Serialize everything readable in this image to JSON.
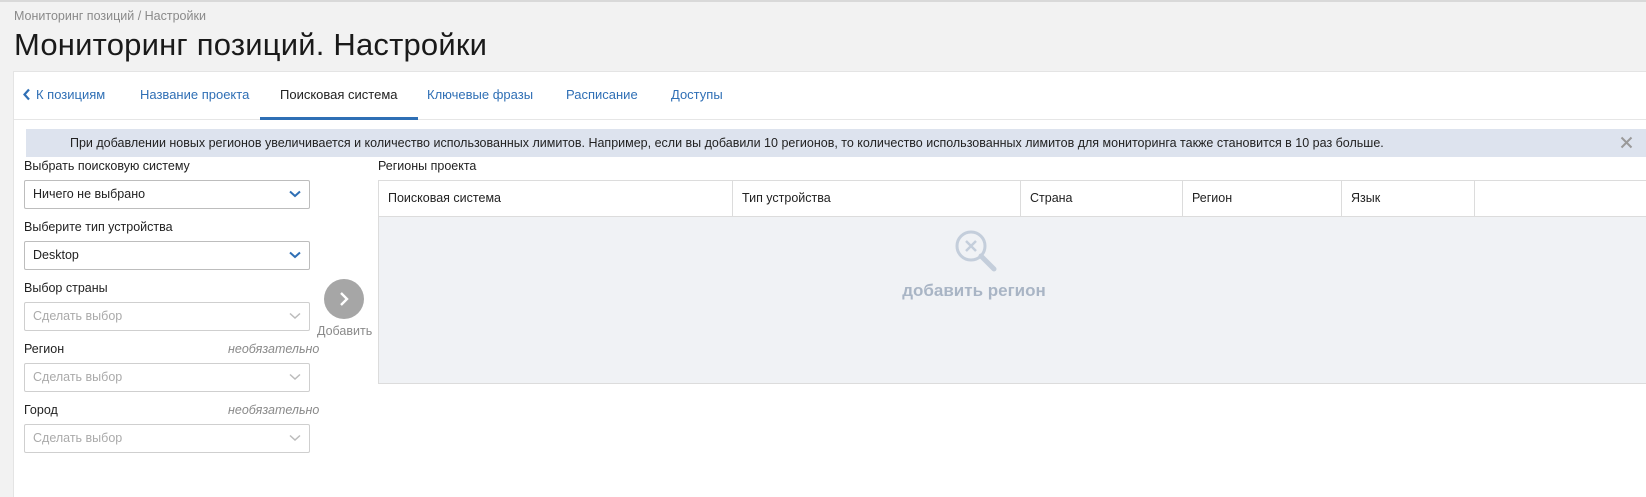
{
  "breadcrumb": "Мониторинг позиций / Настройки",
  "page_title": "Мониторинг позиций. Настройки",
  "tabs": {
    "back": "К позициям",
    "items": [
      "Название проекта",
      "Поисковая система",
      "Ключевые фразы",
      "Расписание",
      "Доступы"
    ],
    "active": "Поисковая система"
  },
  "notice": {
    "text": "При добавлении новых регионов увеличивается и количество использованных лимитов. Например, если вы добавили 10 регионов, то количество использованных лимитов для мониторинга также становится в 10 раз больше."
  },
  "form": {
    "search_engine": {
      "label": "Выбрать поисковую систему",
      "value": "Ничего не выбрано"
    },
    "device": {
      "label": "Выберите тип устройства",
      "value": "Desktop"
    },
    "country": {
      "label": "Выбор страны",
      "placeholder": "Сделать выбор"
    },
    "region": {
      "label": "Регион",
      "optional": "необязательно",
      "placeholder": "Сделать выбор"
    },
    "city": {
      "label": "Город",
      "optional": "необязательно",
      "placeholder": "Сделать выбор"
    },
    "add_label": "Добавить"
  },
  "regions": {
    "title": "Регионы проекта",
    "columns": [
      "Поисковая система",
      "Тип устройства",
      "Страна",
      "Регион",
      "Язык"
    ],
    "empty_text": "добавить регион"
  },
  "colors": {
    "accent": "#2f6fb5",
    "notice_bg": "#dde3ee",
    "empty_text": "#a9b5c5"
  }
}
